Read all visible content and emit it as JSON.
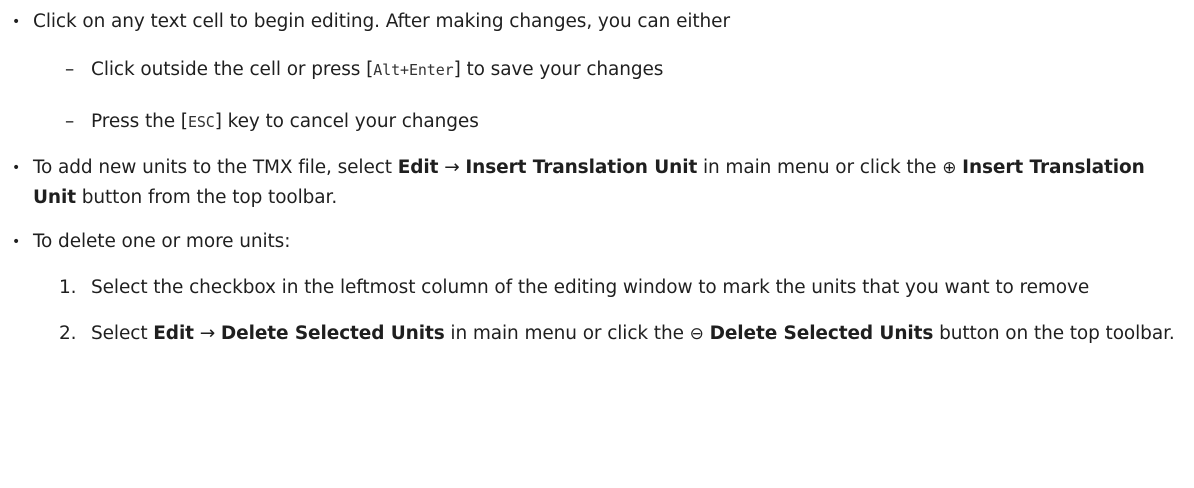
{
  "bullets": {
    "edit": {
      "text": "Click on any text cell to begin editing. After making changes, you can either",
      "options": [
        {
          "pre": "Click outside the cell or press [",
          "key": "Alt+Enter",
          "post": "] to save your changes"
        },
        {
          "pre": "Press the [",
          "key": "ESC",
          "post": "] key to cancel your changes"
        }
      ]
    },
    "add": {
      "pre": "To add new units to the TMX file, select ",
      "menu1": "Edit",
      "arrow": "→",
      "menu2": "Insert Translation Unit",
      "mid": " in main menu or click the ",
      "icon_glyph": "⊕",
      "button": "Insert Translation Unit",
      "post": " button from the top toolbar."
    },
    "delete": {
      "intro": "To delete one or more units:",
      "steps": [
        {
          "number": "1.",
          "text": "Select the checkbox in the leftmost column of the editing window to mark the units that you want to remove"
        },
        {
          "number": "2.",
          "pre": "Select ",
          "menu1": "Edit",
          "arrow": "→",
          "menu2": "Delete Selected Units",
          "mid": " in main menu or click the ",
          "icon_glyph": "⊖",
          "button": "Delete Selected Units",
          "post": " button on the top toolbar."
        }
      ]
    }
  }
}
